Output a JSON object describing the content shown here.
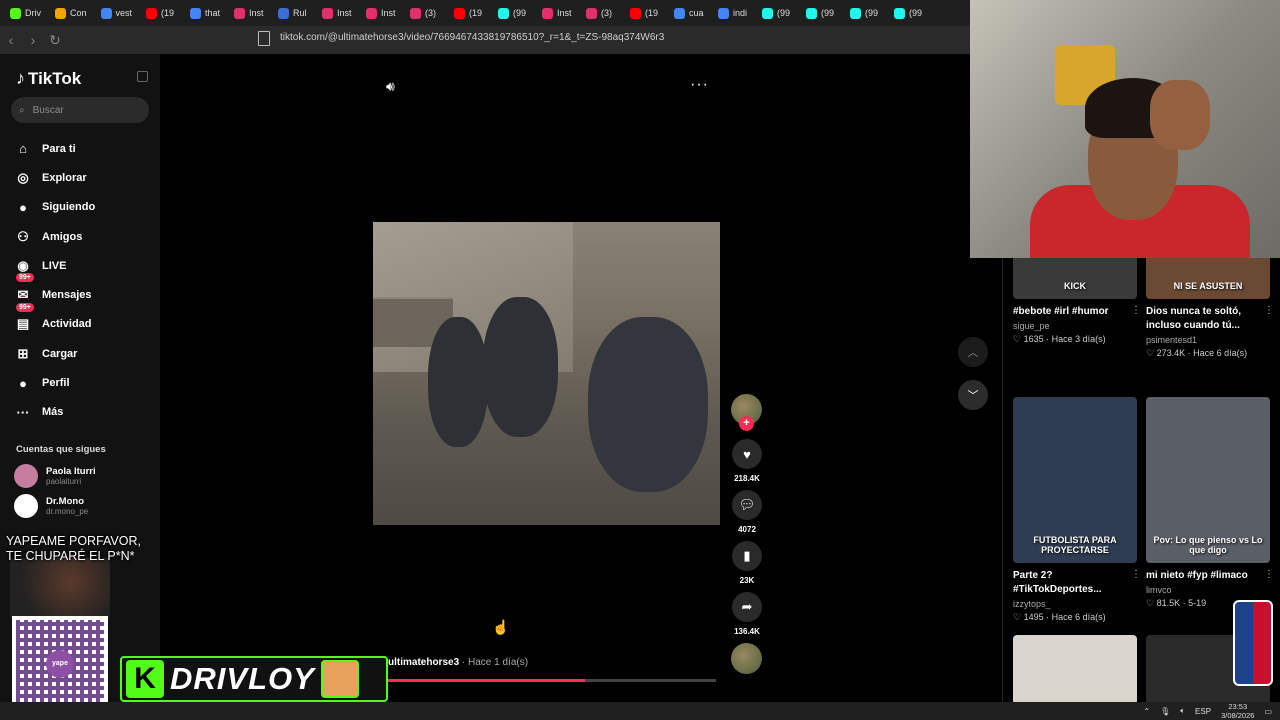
{
  "browser": {
    "tabs": [
      {
        "label": "Driv",
        "color": "#53fc18"
      },
      {
        "label": "Con",
        "color": "#f0a500"
      },
      {
        "label": "vest",
        "color": "#4285f4"
      },
      {
        "label": "(19",
        "color": "#ff0000"
      },
      {
        "label": "that",
        "color": "#4285f4"
      },
      {
        "label": "Inst",
        "color": "#e1306c"
      },
      {
        "label": "Rul",
        "color": "#3a6fd8"
      },
      {
        "label": "Inst",
        "color": "#e1306c"
      },
      {
        "label": "Inst",
        "color": "#e1306c"
      },
      {
        "label": "(3)",
        "color": "#e1306c"
      },
      {
        "label": "(19",
        "color": "#ff0000"
      },
      {
        "label": "(99",
        "color": "#25f4ee"
      },
      {
        "label": "Inst",
        "color": "#e1306c"
      },
      {
        "label": "(3)",
        "color": "#e1306c"
      },
      {
        "label": "(19",
        "color": "#ff0000"
      },
      {
        "label": "cua",
        "color": "#4285f4"
      },
      {
        "label": "indi",
        "color": "#4285f4"
      },
      {
        "label": "(99",
        "color": "#25f4ee"
      },
      {
        "label": "(99",
        "color": "#25f4ee"
      },
      {
        "label": "(99",
        "color": "#25f4ee"
      },
      {
        "label": "(99",
        "color": "#25f4ee"
      }
    ],
    "url": "tiktok.com/@ultimatehorse3/video/7669467433819786510?_r=1&_t=ZS-98aq374W6r3"
  },
  "sidebar": {
    "logo": "TikTok",
    "search_placeholder": "Buscar",
    "items": [
      {
        "label": "Para ti",
        "icon": "home-icon",
        "glyph": "⌂"
      },
      {
        "label": "Explorar",
        "icon": "compass-icon",
        "glyph": "◎"
      },
      {
        "label": "Siguiendo",
        "icon": "following-avatar-icon",
        "glyph": "●"
      },
      {
        "label": "Amigos",
        "icon": "friends-icon",
        "glyph": "⚇"
      },
      {
        "label": "LIVE",
        "icon": "live-icon",
        "glyph": "◉"
      },
      {
        "label": "Mensajes",
        "icon": "messages-icon",
        "glyph": "✉",
        "badge": "99+"
      },
      {
        "label": "Actividad",
        "icon": "activity-icon",
        "glyph": "▤",
        "badge": "99+"
      },
      {
        "label": "Cargar",
        "icon": "upload-icon",
        "glyph": "⊞"
      },
      {
        "label": "Perfil",
        "icon": "profile-icon",
        "glyph": "●"
      },
      {
        "label": "Más",
        "icon": "more-icon",
        "glyph": "···"
      }
    ],
    "follows_title": "Cuentas que sigues",
    "follows": [
      {
        "name": "Paola Iturri",
        "handle": "paolaiturri",
        "color": "#c77da0"
      },
      {
        "name": "Dr.Mono",
        "handle": "dr.mono_pe",
        "color": "#ffffff"
      }
    ]
  },
  "video": {
    "caption_user": "ultimatehorse3",
    "caption_time": " · Hace 1 día(s)",
    "progress": 0.6,
    "likes": "218.4K",
    "comments": "4072",
    "saves": "23K",
    "shares": "136.4K"
  },
  "related": [
    {
      "title": "#bebote #irl #humor",
      "user": "sigue_pe",
      "stats": "♡ 1635 · Hace 3 día(s)",
      "thumb_text": "KICK",
      "thumb_bg": "#3a3a3a"
    },
    {
      "title": "Dios nunca te soltó, incluso cuando tú...",
      "user": "psimentesd1",
      "stats": "♡ 273.4K · Hace 6 día(s)",
      "thumb_text": "NI SE ASUSTEN",
      "thumb_bg": "#6b4a34"
    },
    {
      "title": "Parte 2? #TikTokDeportes...",
      "user": "izzytops_",
      "stats": "♡ 1495 · Hace 6 día(s)",
      "thumb_text": "FUTBOLISTA PARA PROYECTARSE",
      "thumb_bg": "#2f3d52"
    },
    {
      "title": "mi nieto #fyp #limaco",
      "user": "limvco",
      "stats": "♡ 81.5K · 5-19",
      "thumb_text": "Pov: Lo que pienso vs Lo que digo",
      "thumb_bg": "#5a5e66"
    }
  ],
  "overlay": {
    "line1": "YAPEAME PORFAVOR,",
    "line2": "TE CHUPARÉ  EL P*N*",
    "qr_label": "yape",
    "brand": "DRIVLOY",
    "brand_letter": "K"
  },
  "taskbar": {
    "lang": "ESP",
    "time": "23:53",
    "date": "3/08/2026"
  }
}
